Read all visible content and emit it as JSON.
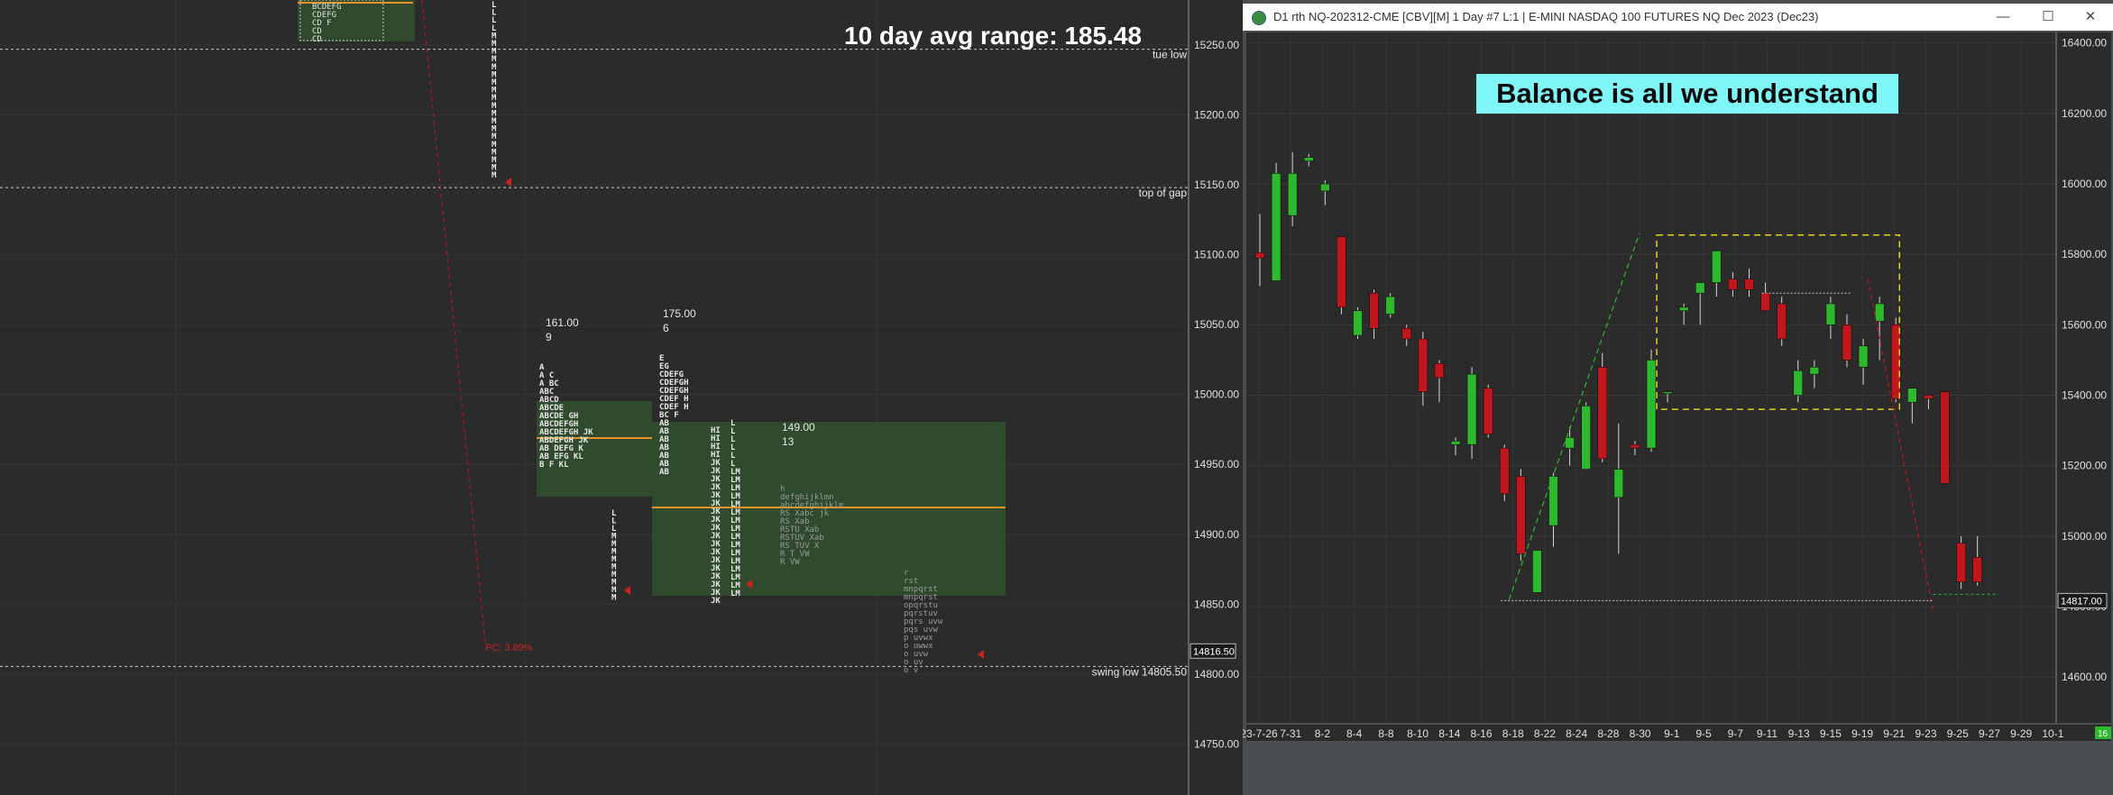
{
  "left_panel": {
    "avg_range_label": "10 day avg range:  185.48",
    "price_ticks": [
      "15250.00",
      "15200.00",
      "15150.00",
      "15100.00",
      "15050.00",
      "15000.00",
      "14950.00",
      "14900.00",
      "14850.00",
      "14800.00",
      "14750.00"
    ],
    "reference_lines": [
      {
        "label": "tue low",
        "price": 15247
      },
      {
        "label": "top of gap",
        "price": 15148
      },
      {
        "label": "swing low  14805.50",
        "price": 14805.5
      }
    ],
    "current_price_label": "14816.50",
    "current_price": 14816.5,
    "pc_label": "PC: 3.89%",
    "profile_stats": [
      {
        "range": "161.00",
        "count": "9"
      },
      {
        "range": "175.00",
        "count": "6"
      },
      {
        "range": "149.00",
        "count": "13"
      }
    ],
    "colors": {
      "background": "#2b2b2b",
      "value_area": "#2f4a2c",
      "poc_line": "#e6922a",
      "letters": "#e8e8e8",
      "red_marker": "#d02020"
    }
  },
  "right_panel": {
    "window_title": "D1 rth NQ-202312-CME [CBV][M]  1 Day  #7 L:1 | E-MINI NASDAQ 100 FUTURES NQ Dec 2023 (Dec23)",
    "window_buttons": {
      "minimize": "—",
      "maximize": "☐",
      "close": "✕"
    },
    "annotation": "Balance is all we understand",
    "last_price_label": "14817.00",
    "corner_label": "16",
    "colors": {
      "background": "#2b2b2b",
      "up": "#2db82d",
      "down": "#c0161c",
      "balance_box": "#e6d21f",
      "annotation_bg": "#7ff6f8"
    }
  },
  "chart_data": {
    "type": "candlestick",
    "title": "D1 rth NQ-202312-CME [CBV][M]  1 Day  #7 L:1 | E-MINI NASDAQ 100 FUTURES NQ Dec 2023 (Dec23)",
    "y_ticks": [
      "16400.00",
      "16200.00",
      "16000.00",
      "15800.00",
      "15600.00",
      "15400.00",
      "15200.00",
      "15000.00",
      "14800.00",
      "14600.00"
    ],
    "ylim": [
      14470,
      16430
    ],
    "x_tick_labels": [
      "23-7-26",
      "7-31",
      "8-2",
      "8-4",
      "8-8",
      "8-10",
      "8-14",
      "8-16",
      "8-18",
      "8-22",
      "8-24",
      "8-28",
      "8-30",
      "9-1",
      "9-5",
      "9-7",
      "9-11",
      "9-13",
      "9-15",
      "9-19",
      "9-21",
      "9-23",
      "9-25",
      "9-27",
      "9-29",
      "10-1"
    ],
    "candles": [
      {
        "o": 15805,
        "h": 15915,
        "l": 15710,
        "c": 15790
      },
      {
        "o": 15725,
        "h": 16060,
        "l": 15725,
        "c": 16030
      },
      {
        "o": 15910,
        "h": 16090,
        "l": 15880,
        "c": 16030
      },
      {
        "o": 16065,
        "h": 16085,
        "l": 16050,
        "c": 16075
      },
      {
        "o": 15980,
        "h": 16010,
        "l": 15940,
        "c": 16000
      },
      {
        "o": 15850,
        "h": 15850,
        "l": 15630,
        "c": 15650
      },
      {
        "o": 15570,
        "h": 15650,
        "l": 15560,
        "c": 15640
      },
      {
        "o": 15690,
        "h": 15700,
        "l": 15560,
        "c": 15590
      },
      {
        "o": 15630,
        "h": 15690,
        "l": 15620,
        "c": 15680
      },
      {
        "o": 15590,
        "h": 15600,
        "l": 15540,
        "c": 15560
      },
      {
        "o": 15560,
        "h": 15580,
        "l": 15370,
        "c": 15410
      },
      {
        "o": 15490,
        "h": 15500,
        "l": 15380,
        "c": 15450
      },
      {
        "o": 15260,
        "h": 15280,
        "l": 15230,
        "c": 15270
      },
      {
        "o": 15260,
        "h": 15480,
        "l": 15220,
        "c": 15460
      },
      {
        "o": 15420,
        "h": 15430,
        "l": 15280,
        "c": 15290
      },
      {
        "o": 15250,
        "h": 15260,
        "l": 15100,
        "c": 15120
      },
      {
        "o": 15170,
        "h": 15190,
        "l": 14930,
        "c": 14950
      },
      {
        "o": 14840,
        "h": 14960,
        "l": 14840,
        "c": 14960
      },
      {
        "o": 15030,
        "h": 15180,
        "l": 14970,
        "c": 15170
      },
      {
        "o": 15250,
        "h": 15310,
        "l": 15200,
        "c": 15280
      },
      {
        "o": 15190,
        "h": 15380,
        "l": 15190,
        "c": 15370
      },
      {
        "o": 15480,
        "h": 15520,
        "l": 15210,
        "c": 15220
      },
      {
        "o": 15110,
        "h": 15320,
        "l": 14950,
        "c": 15190
      },
      {
        "o": 15260,
        "h": 15270,
        "l": 15230,
        "c": 15250
      },
      {
        "o": 15250,
        "h": 15530,
        "l": 15240,
        "c": 15500
      },
      {
        "o": 15410,
        "h": 15400,
        "l": 15380,
        "c": 15410
      },
      {
        "o": 15640,
        "h": 15660,
        "l": 15600,
        "c": 15650
      },
      {
        "o": 15690,
        "h": 15720,
        "l": 15600,
        "c": 15720
      },
      {
        "o": 15720,
        "h": 15770,
        "l": 15680,
        "c": 15810
      },
      {
        "o": 15730,
        "h": 15750,
        "l": 15680,
        "c": 15700
      },
      {
        "o": 15730,
        "h": 15760,
        "l": 15680,
        "c": 15700
      },
      {
        "o": 15690,
        "h": 15720,
        "l": 15660,
        "c": 15640
      },
      {
        "o": 15660,
        "h": 15680,
        "l": 15540,
        "c": 15560
      },
      {
        "o": 15400,
        "h": 15500,
        "l": 15380,
        "c": 15470
      },
      {
        "o": 15460,
        "h": 15500,
        "l": 15420,
        "c": 15480
      },
      {
        "o": 15600,
        "h": 15680,
        "l": 15560,
        "c": 15660
      },
      {
        "o": 15600,
        "h": 15630,
        "l": 15480,
        "c": 15500
      },
      {
        "o": 15480,
        "h": 15560,
        "l": 15430,
        "c": 15540
      },
      {
        "o": 15610,
        "h": 15680,
        "l": 15500,
        "c": 15660
      },
      {
        "o": 15600,
        "h": 15620,
        "l": 15380,
        "c": 15390
      },
      {
        "o": 15380,
        "h": 15420,
        "l": 15320,
        "c": 15420
      },
      {
        "o": 15400,
        "h": 15400,
        "l": 15360,
        "c": 15390
      },
      {
        "o": 15410,
        "h": 15410,
        "l": 15150,
        "c": 15150
      },
      {
        "o": 14980,
        "h": 15000,
        "l": 14850,
        "c": 14870
      },
      {
        "o": 14940,
        "h": 15000,
        "l": 14860,
        "c": 14870
      }
    ]
  }
}
